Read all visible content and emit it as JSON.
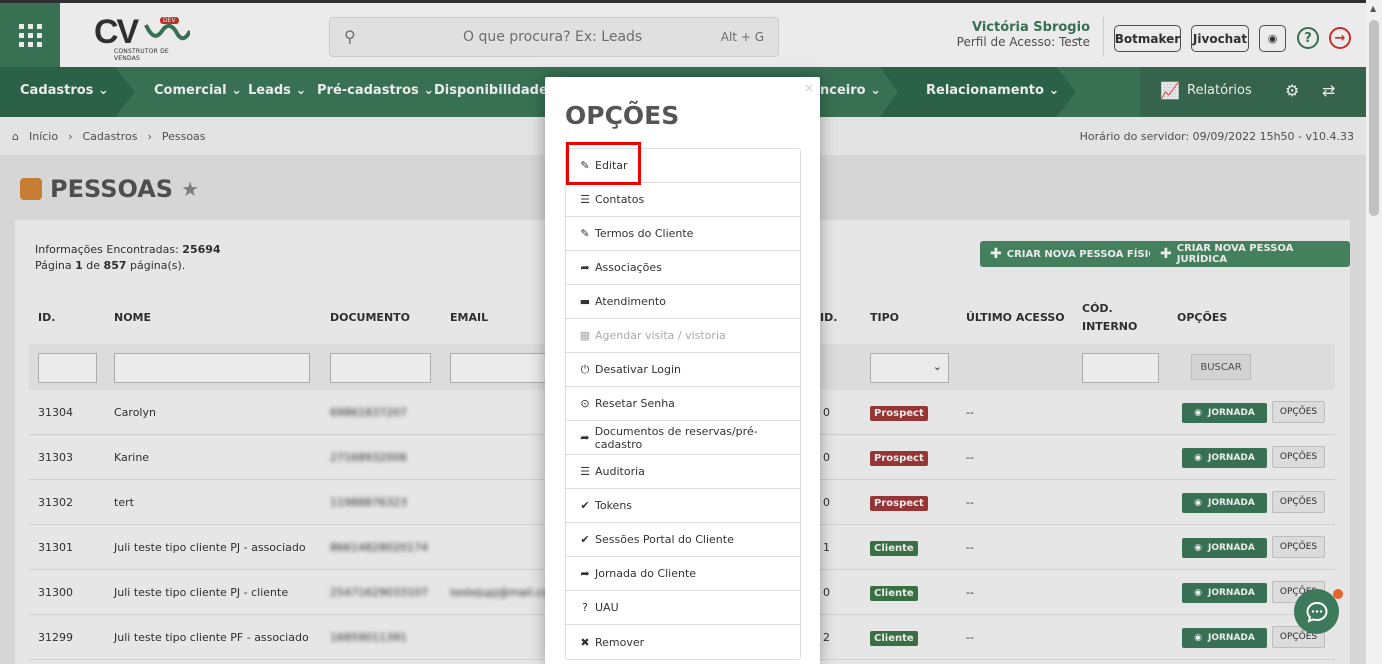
{
  "header": {
    "logo_text": "CV",
    "logo_badge": "DEV",
    "logo_tagline": "CONSTRUTOR DE VENDAS",
    "search_placeholder": "O que procura? Ex: Leads",
    "search_shortcut": "Alt + G",
    "user_name": "Victória Sbrogio",
    "user_role": "Perfil de Acesso: Teste",
    "botmaker_label": "Botmaker",
    "jivochat_label": "Jivochat"
  },
  "nav": {
    "items": [
      "Cadastros",
      "Comercial",
      "Leads",
      "Pré-cadastros",
      "Disponibilidade",
      "nceiro",
      "Relacionamento"
    ],
    "relatorios": "Relatórios"
  },
  "breadcrumb": {
    "items": [
      "Início",
      "Cadastros",
      "Pessoas"
    ],
    "server_time": "Horário do servidor: 09/09/2022 15h50 - v10.4.33"
  },
  "page": {
    "title": "PESSOAS",
    "info_found_label": "Informações Encontradas:",
    "info_found_value": "25694",
    "page_word": "Página",
    "page_current": "1",
    "page_of": "de",
    "page_total": "857",
    "page_suffix": "página(s).",
    "btn_pf": "CRIAR NOVA PESSOA FÍSICA",
    "btn_pj": "CRIAR NOVA PESSOA JURÍDICA"
  },
  "table": {
    "headers": {
      "id": "ID.",
      "nome": "NOME",
      "documento": "DOCUMENTO",
      "email": "EMAIL",
      "id2": "ID.",
      "tipo": "TIPO",
      "ultimo_acesso": "ÚLTIMO ACESSO",
      "cod_interno_1": "CÓD.",
      "cod_interno_2": "INTERNO",
      "opcoes": "OPÇÕES"
    },
    "buscar_label": "BUSCAR",
    "jornada_label": "JORNADA",
    "opcoes_label": "OPÇÕES",
    "rows": [
      {
        "id": "31304",
        "nome": "Carolyn",
        "doc": "69861837207",
        "email": "",
        "idv": "0",
        "tipo": "Prospect",
        "acesso": "--"
      },
      {
        "id": "31303",
        "nome": "Karine",
        "doc": "27168932006",
        "email": "",
        "idv": "0",
        "tipo": "Prospect",
        "acesso": "--"
      },
      {
        "id": "31302",
        "nome": "tert",
        "doc": "11988876323",
        "email": "",
        "idv": "0",
        "tipo": "Prospect",
        "acesso": "--"
      },
      {
        "id": "31301",
        "nome": "Juli teste tipo cliente PJ - associado",
        "doc": "86614828020174",
        "email": "",
        "idv": "1",
        "tipo": "Cliente",
        "acesso": "--"
      },
      {
        "id": "31300",
        "nome": "Juli teste tipo cliente PJ - cliente",
        "doc": "25471629033107",
        "email": "testejupj@mail.com",
        "idv": "0",
        "tipo": "Cliente",
        "acesso": "--"
      },
      {
        "id": "31299",
        "nome": "Juli teste tipo cliente PF - associado",
        "doc": "16859011391",
        "email": "",
        "idv": "2",
        "tipo": "Cliente",
        "acesso": "--"
      }
    ]
  },
  "modal": {
    "close": "×",
    "title": "OPÇÕES",
    "items": [
      {
        "label": "Editar",
        "icon": "✎"
      },
      {
        "label": "Contatos",
        "icon": "☰"
      },
      {
        "label": "Termos do Cliente",
        "icon": "✎"
      },
      {
        "label": "Associações",
        "icon": "➦"
      },
      {
        "label": "Atendimento",
        "icon": "▬"
      },
      {
        "label": "Agendar visita / vistoria",
        "icon": "▦"
      },
      {
        "label": "Desativar Login",
        "icon": "⏻"
      },
      {
        "label": "Resetar Senha",
        "icon": "⊙"
      },
      {
        "label": "Documentos de reservas/pré-cadastro",
        "icon": "➦"
      },
      {
        "label": "Auditoria",
        "icon": "☰"
      },
      {
        "label": "Tokens",
        "icon": "✔"
      },
      {
        "label": "Sessões Portal do Cliente",
        "icon": "✔"
      },
      {
        "label": "Jornada do Cliente",
        "icon": "➦"
      },
      {
        "label": "UAU",
        "icon": "?"
      },
      {
        "label": "Remover",
        "icon": "✖"
      }
    ]
  },
  "colors": {
    "brand_green": "#3d7a5b",
    "prospect_red": "#a33a3a",
    "cliente_green": "#3d7a4a",
    "highlight_red": "#ee0000"
  }
}
